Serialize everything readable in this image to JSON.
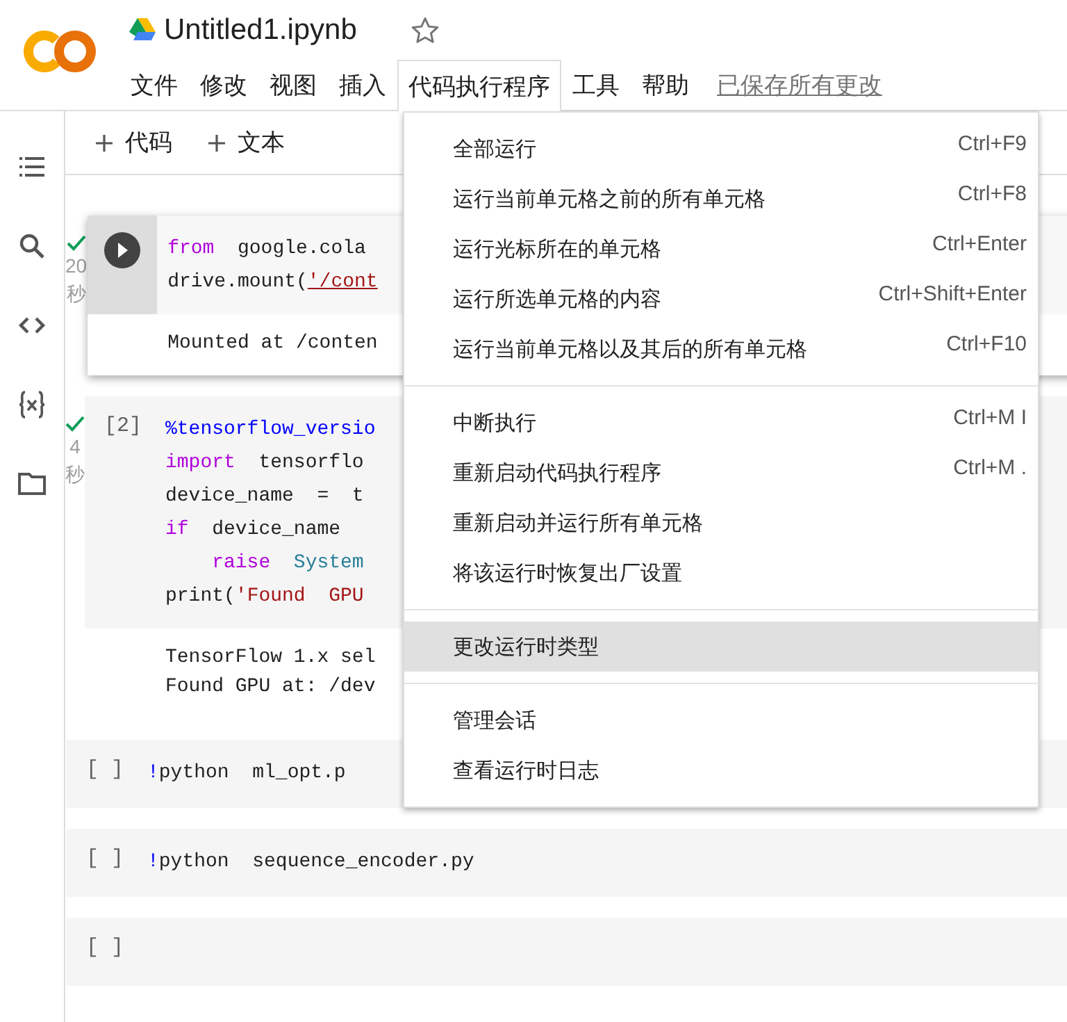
{
  "header": {
    "title": "Untitled1.ipynb",
    "starred": false,
    "menus": [
      {
        "label": "文件",
        "selected": false
      },
      {
        "label": "修改",
        "selected": false
      },
      {
        "label": "视图",
        "selected": false
      },
      {
        "label": "插入",
        "selected": false
      },
      {
        "label": "代码执行程序",
        "selected": true
      },
      {
        "label": "工具",
        "selected": false
      },
      {
        "label": "帮助",
        "selected": false
      }
    ],
    "saved_status": "已保存所有更改"
  },
  "toolbar": [
    {
      "label": "代码"
    },
    {
      "label": "文本"
    }
  ],
  "cells": [
    {
      "focused": true,
      "done": true,
      "elapsed": "20",
      "unit": "秒",
      "lines": [
        [
          {
            "kind": "keyword",
            "text": "from"
          },
          {
            "kind": "plain",
            "text": "  google.cola"
          }
        ],
        [
          {
            "kind": "plain",
            "text": "drive.mount("
          },
          {
            "kind": "link",
            "text": "'/cont"
          }
        ]
      ],
      "output": [
        "Mounted at /conten"
      ]
    },
    {
      "focused": false,
      "done": true,
      "elapsed": "4",
      "unit": "秒",
      "prompt": "[2]",
      "lines": [
        [
          {
            "kind": "magic",
            "text": "%tensorflow_versio"
          }
        ],
        [
          {
            "kind": "keyword",
            "text": "import"
          },
          {
            "kind": "plain",
            "text": "  tensorflo"
          }
        ],
        [
          {
            "kind": "plain",
            "text": "device_name  =  t"
          }
        ],
        [
          {
            "kind": "keyword",
            "text": "if"
          },
          {
            "kind": "plain",
            "text": "  device_name"
          }
        ],
        [
          {
            "kind": "keyword",
            "text": "    raise"
          },
          {
            "kind": "type",
            "text": "  System"
          }
        ],
        [
          {
            "kind": "plain",
            "text": "print("
          },
          {
            "kind": "string",
            "text": "'Found  GPU"
          }
        ]
      ],
      "output": [
        "TensorFlow 1.x sel",
        "Found GPU at: /dev"
      ]
    },
    {
      "focused": false,
      "done": false,
      "prompt": "[ ]",
      "lines": [
        [
          {
            "kind": "magic",
            "text": "!"
          },
          {
            "kind": "plain",
            "text": "python  ml_opt.p"
          }
        ]
      ]
    },
    {
      "focused": false,
      "done": false,
      "prompt": "[ ]",
      "lines": [
        [
          {
            "kind": "magic",
            "text": "!"
          },
          {
            "kind": "plain",
            "text": "python  sequence_encoder.py"
          }
        ]
      ]
    },
    {
      "focused": false,
      "done": false,
      "prompt": "[ ]"
    }
  ],
  "menu": {
    "groups": [
      [
        {
          "label": "全部运行",
          "shortcut": "Ctrl+F9",
          "selected": false
        },
        {
          "label": "运行当前单元格之前的所有单元格",
          "shortcut": "Ctrl+F8",
          "selected": false
        },
        {
          "label": "运行光标所在的单元格",
          "shortcut": "Ctrl+Enter",
          "selected": false
        },
        {
          "label": "运行所选单元格的内容",
          "shortcut": "Ctrl+Shift+Enter",
          "selected": false
        },
        {
          "label": "运行当前单元格以及其后的所有单元格",
          "shortcut": "Ctrl+F10",
          "selected": false
        }
      ],
      [
        {
          "label": "中断执行",
          "shortcut": "Ctrl+M I",
          "selected": false
        },
        {
          "label": "重新启动代码执行程序",
          "shortcut": "Ctrl+M .",
          "selected": false
        },
        {
          "label": "重新启动并运行所有单元格",
          "selected": false
        },
        {
          "label": "将该运行时恢复出厂设置",
          "selected": false
        }
      ],
      [
        {
          "label": "更改运行时类型",
          "selected": true
        }
      ],
      [
        {
          "label": "管理会话",
          "selected": false
        },
        {
          "label": "查看运行时日志",
          "selected": false
        }
      ]
    ]
  }
}
